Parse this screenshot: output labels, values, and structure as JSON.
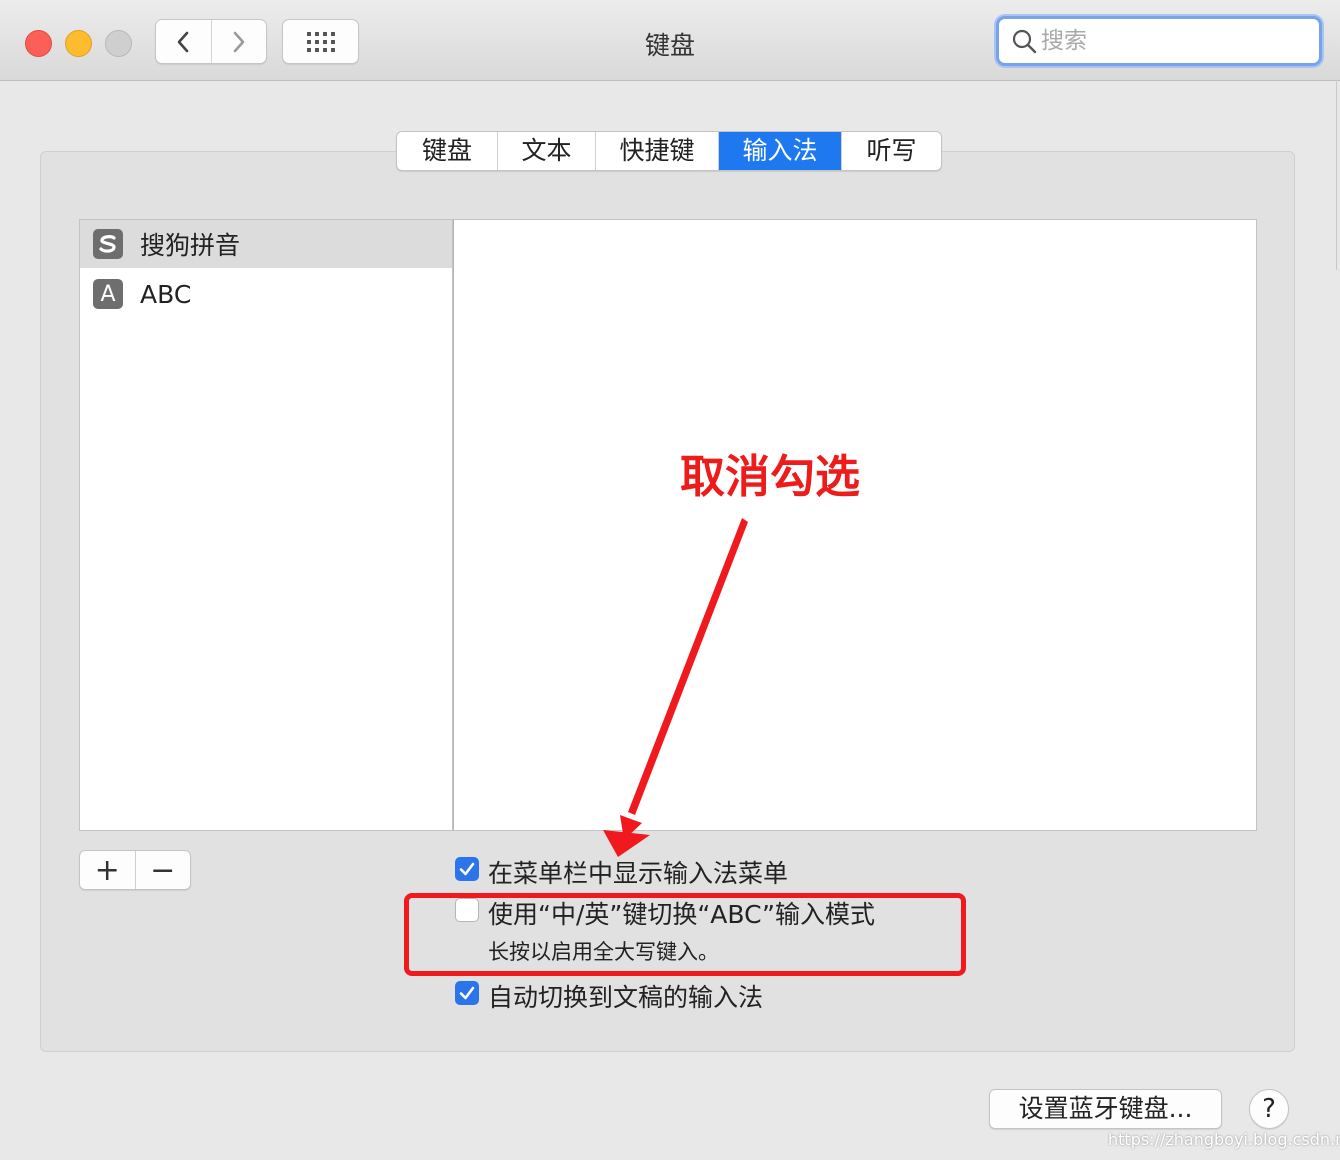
{
  "window": {
    "title": "键盘",
    "search_placeholder": "搜索"
  },
  "tabs": [
    {
      "label": "键盘",
      "active": false
    },
    {
      "label": "文本",
      "active": false
    },
    {
      "label": "快捷键",
      "active": false
    },
    {
      "label": "输入法",
      "active": true
    },
    {
      "label": "听写",
      "active": false
    }
  ],
  "input_sources": [
    {
      "icon": "sogou-icon",
      "label": "搜狗拼音",
      "selected": true
    },
    {
      "icon": "abc-icon",
      "icon_letter": "A",
      "label": "ABC",
      "selected": false
    }
  ],
  "list_controls": {
    "add": "+",
    "remove": "−"
  },
  "options": [
    {
      "label": "在菜单栏中显示输入法菜单",
      "checked": true
    },
    {
      "label": "使用“中/英”键切换“ABC”输入模式",
      "checked": false,
      "sublabel": "长按以启用全大写键入。"
    },
    {
      "label": "自动切换到文稿的输入法",
      "checked": true
    }
  ],
  "annotation": {
    "text": "取消勾选",
    "color": "#ee1b1b"
  },
  "footer": {
    "bluetooth_button": "设置蓝牙键盘...",
    "help_button": "?"
  },
  "watermark": "https://zhangboyi.blog.csdn.net",
  "colors": {
    "accent": "#1e79f0",
    "checkbox": "#2b74ea",
    "annotation_red": "#f0191e"
  }
}
